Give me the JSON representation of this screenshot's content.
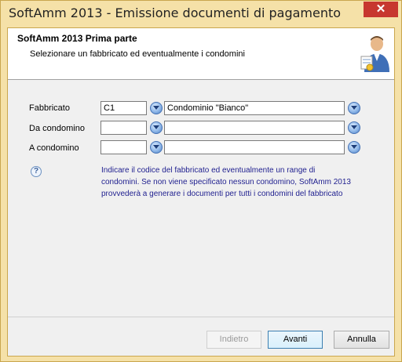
{
  "window": {
    "title": "SoftAmm 2013 - Emissione documenti di pagamento",
    "close_glyph": "✕"
  },
  "header": {
    "title": "SoftAmm 2013 Prima parte",
    "subtitle": "Selezionare un fabbricato ed eventualmente i condomini",
    "icon": "user-wizard-icon"
  },
  "form": {
    "fabbricato": {
      "label": "Fabbricato",
      "code": "C1",
      "name": "Condominio \"Bianco\""
    },
    "da_condominio": {
      "label": "Da condomino",
      "code": "",
      "name": ""
    },
    "a_condominio": {
      "label": "A condomino",
      "code": "",
      "name": ""
    }
  },
  "help": {
    "icon": "question-icon",
    "glyph": "?",
    "text": "Indicare il codice del fabbricato ed eventualmente un range di condomini. Se non viene specificato nessun condomino, SoftAmm 2013 provvederà a generare i documenti per tutti i condomini del fabbricato"
  },
  "buttons": {
    "back": "Indietro",
    "next": "Avanti",
    "cancel": "Annulla"
  },
  "colors": {
    "frame": "#f5e1a8",
    "close": "#c7372f",
    "help_text": "#1f1f8f"
  }
}
